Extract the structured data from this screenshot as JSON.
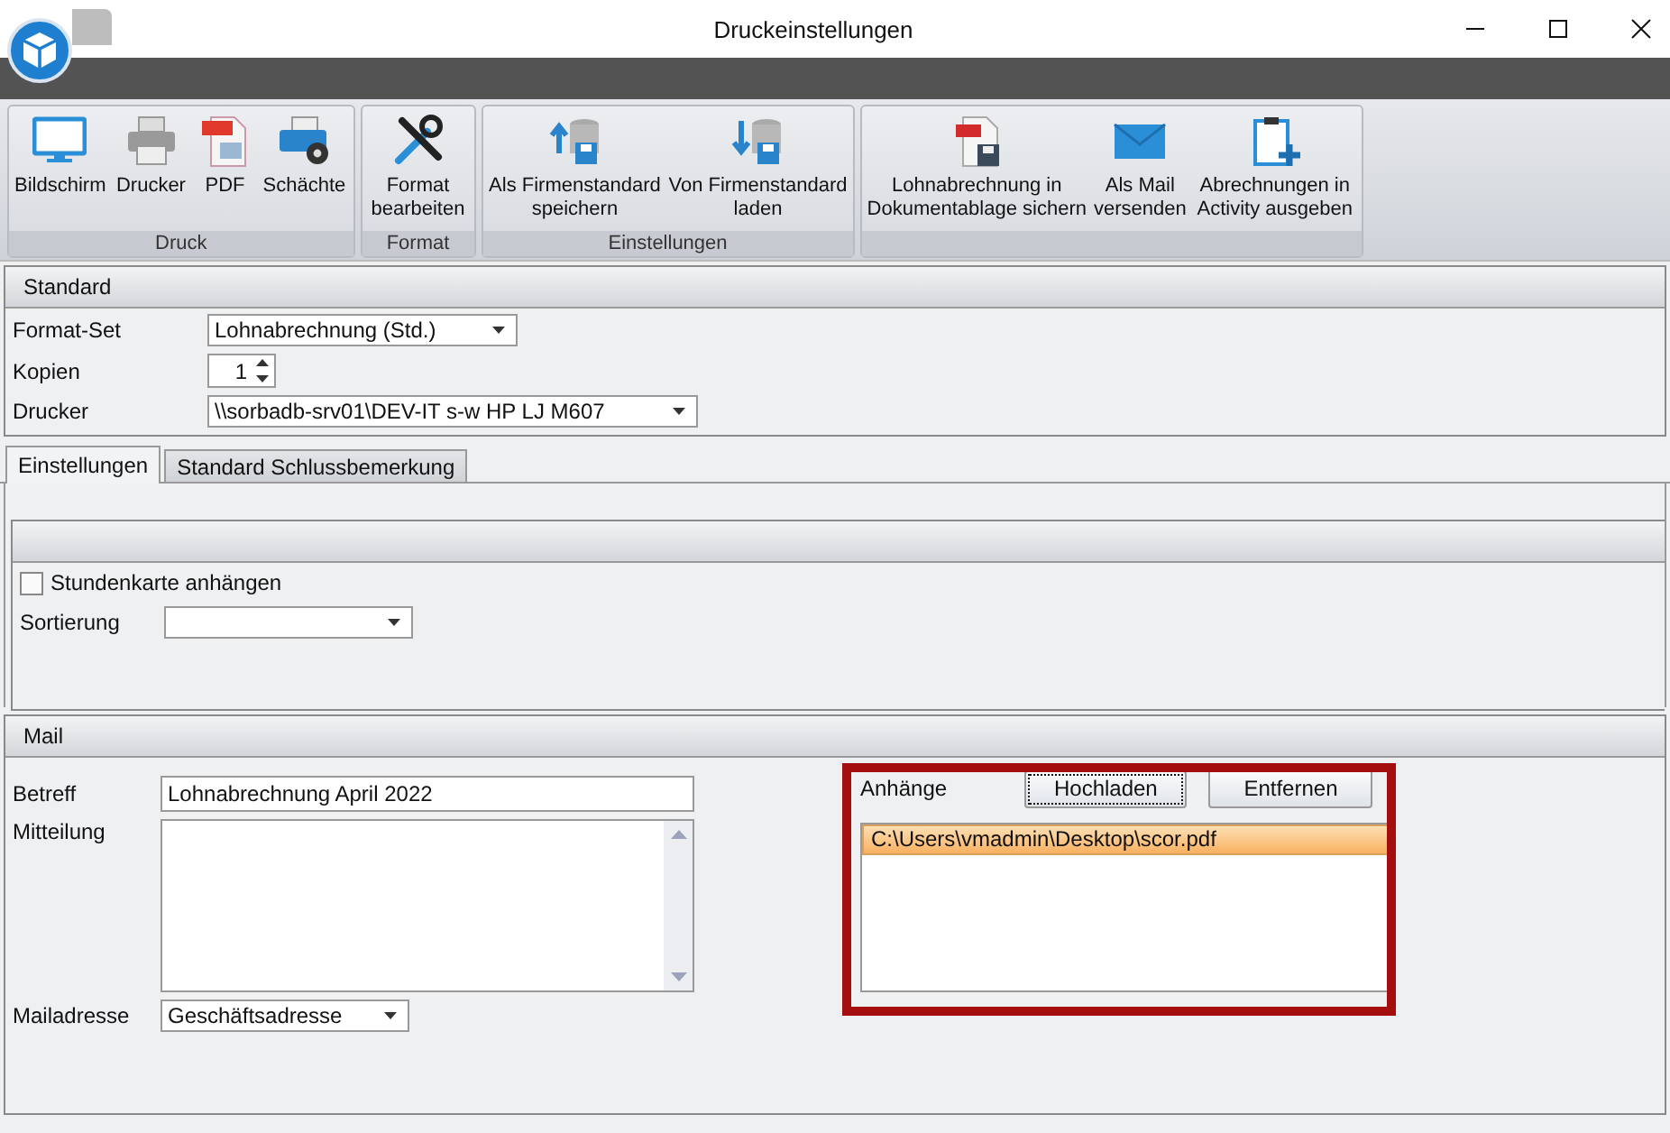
{
  "window": {
    "title": "Druckeinstellungen"
  },
  "ribbon": {
    "groups": [
      {
        "label": "Druck",
        "items": [
          {
            "lines": [
              "Bildschirm"
            ]
          },
          {
            "lines": [
              "Drucker"
            ]
          },
          {
            "lines": [
              "PDF"
            ]
          },
          {
            "lines": [
              "Schächte"
            ]
          }
        ]
      },
      {
        "label": "Format",
        "items": [
          {
            "lines": [
              "Format",
              "bearbeiten"
            ]
          }
        ]
      },
      {
        "label": "Einstellungen",
        "items": [
          {
            "lines": [
              "Als Firmenstandard",
              "speichern"
            ]
          },
          {
            "lines": [
              "Von Firmenstandard",
              "laden"
            ]
          }
        ]
      },
      {
        "items": [
          {
            "lines": [
              "Lohnabrechnung in",
              "Dokumentablage sichern"
            ]
          },
          {
            "lines": [
              "Als Mail",
              "versenden"
            ]
          },
          {
            "lines": [
              "Abrechnungen in",
              "Activity ausgeben"
            ]
          }
        ]
      }
    ]
  },
  "standard": {
    "title": "Standard",
    "fields": [
      {
        "label": "Format-Set",
        "kind": "dropdown",
        "value": "Lohnabrechnung (Std.)"
      },
      {
        "label": "Kopien",
        "kind": "spinner",
        "value": "1"
      },
      {
        "label": "Drucker",
        "kind": "dropdown",
        "value": "\\\\sorbadb-srv01\\DEV-IT s-w HP LJ M607"
      }
    ]
  },
  "tabs": [
    {
      "label": "Einstellungen",
      "selected": true
    },
    {
      "label": "Standard Schlussbemerkung",
      "selected": false
    }
  ],
  "settings": {
    "checkbox": {
      "label": "Stundenkarte anhängen",
      "checked": false
    },
    "sort": {
      "label": "Sortierung"
    }
  },
  "mail": {
    "title": "Mail",
    "subject": {
      "label": "Betreff",
      "value": "Lohnabrechnung April 2022"
    },
    "message": {
      "label": "Mitteilung"
    },
    "address": {
      "label": "Mailadresse",
      "value": "Geschäftsadresse"
    },
    "attachments": {
      "label": "Anhänge",
      "buttons": [
        {
          "label": "Hochladen",
          "focused": true
        },
        {
          "label": "Entfernen",
          "focused": false
        }
      ],
      "items": [
        {
          "path": "C:\\Users\\vmadmin\\Desktop\\scor.pdf",
          "selected": true
        }
      ]
    }
  }
}
